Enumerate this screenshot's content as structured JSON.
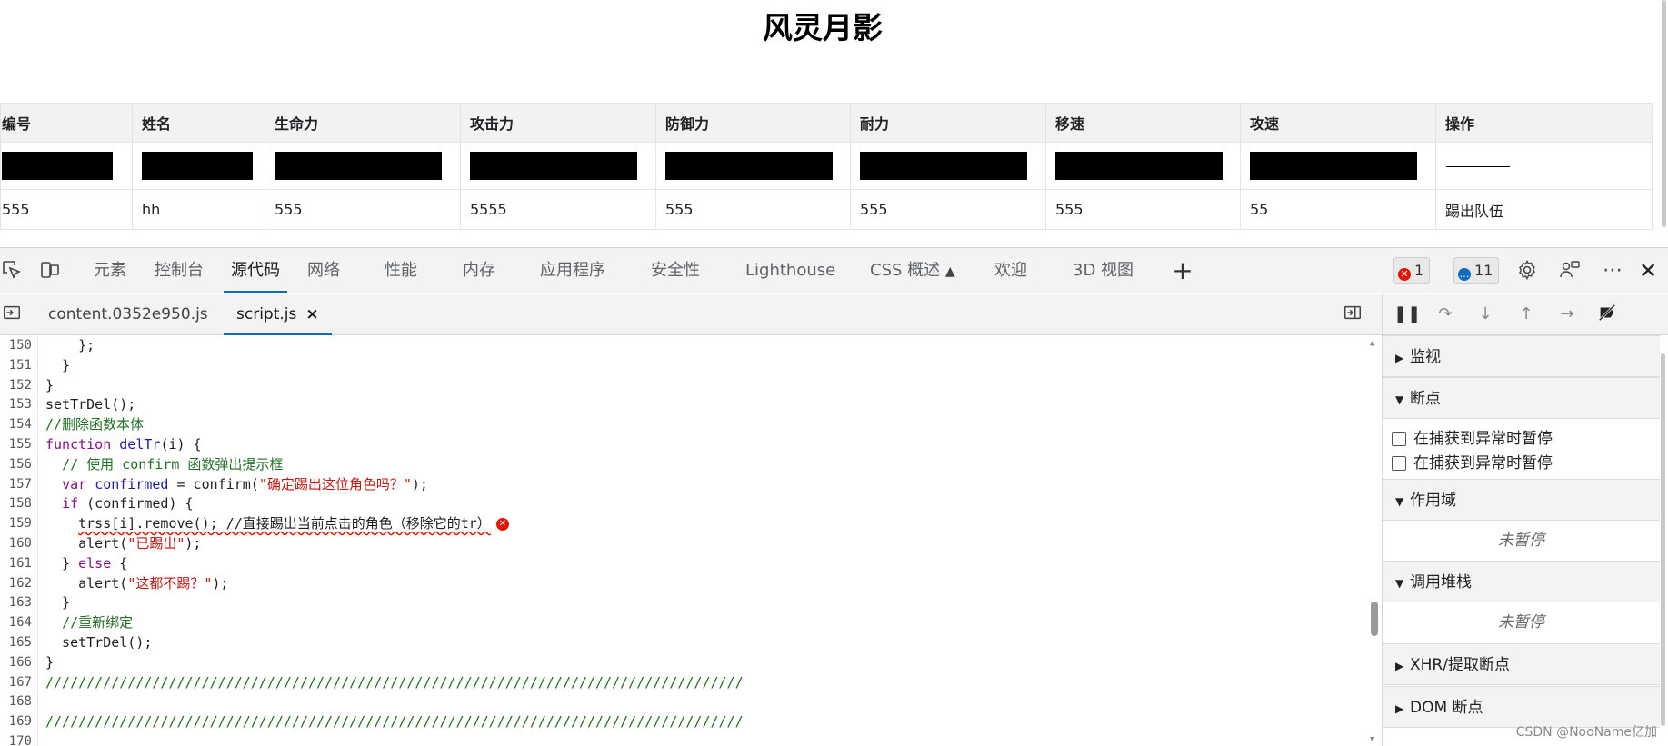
{
  "page": {
    "title": "风灵月影",
    "table": {
      "headers": [
        "编号",
        "姓名",
        "生命力",
        "攻击力",
        "防御力",
        "耐力",
        "移速",
        "攻速",
        "操作"
      ],
      "rows": [
        [
          "555",
          "hh",
          "555",
          "5555",
          "555",
          "555",
          "555",
          "55",
          "踢出队伍"
        ]
      ]
    }
  },
  "devtools": {
    "tabs": [
      "元素",
      "控制台",
      "源代码",
      "网络",
      "性能",
      "内存",
      "应用程序",
      "安全性",
      "Lighthouse",
      "CSS 概述",
      "欢迎",
      "3D 视图"
    ],
    "active_tab": "源代码",
    "error_count": "1",
    "message_count": "11",
    "icons": {
      "inspect": "inspect-element-icon",
      "device": "device-toolbar-icon",
      "add": "plus-icon",
      "settings": "gear-icon",
      "feedback": "feedback-icon",
      "more": "more-icon",
      "close": "close-icon",
      "flask": "flask-icon"
    },
    "file_tabs": [
      {
        "name": "content.0352e950.js",
        "active": false
      },
      {
        "name": "script.js",
        "active": true
      }
    ],
    "file_close_label": "×",
    "editor": {
      "line_numbers": [
        "150",
        "151",
        "152",
        "153",
        "154",
        "155",
        "156",
        "157",
        "158",
        "159",
        "160",
        "161",
        "162",
        "163",
        "164",
        "165",
        "166",
        "167",
        "168",
        "169",
        "170"
      ]
    },
    "sidebar": {
      "sections": {
        "watch": "监视",
        "breakpoints": "断点",
        "scope": "作用域",
        "call_stack": "调用堆栈",
        "xhr": "XHR/提取断点",
        "dom": "DOM 断点"
      },
      "checkboxes": [
        "在捕获到异常时暂停",
        "在捕获到异常时暂停"
      ],
      "not_paused": "未暂停",
      "colors": {
        "accent": "#0f6cbd",
        "error": "#e51400"
      }
    },
    "watermark": "CSDN @NooName亿加"
  }
}
